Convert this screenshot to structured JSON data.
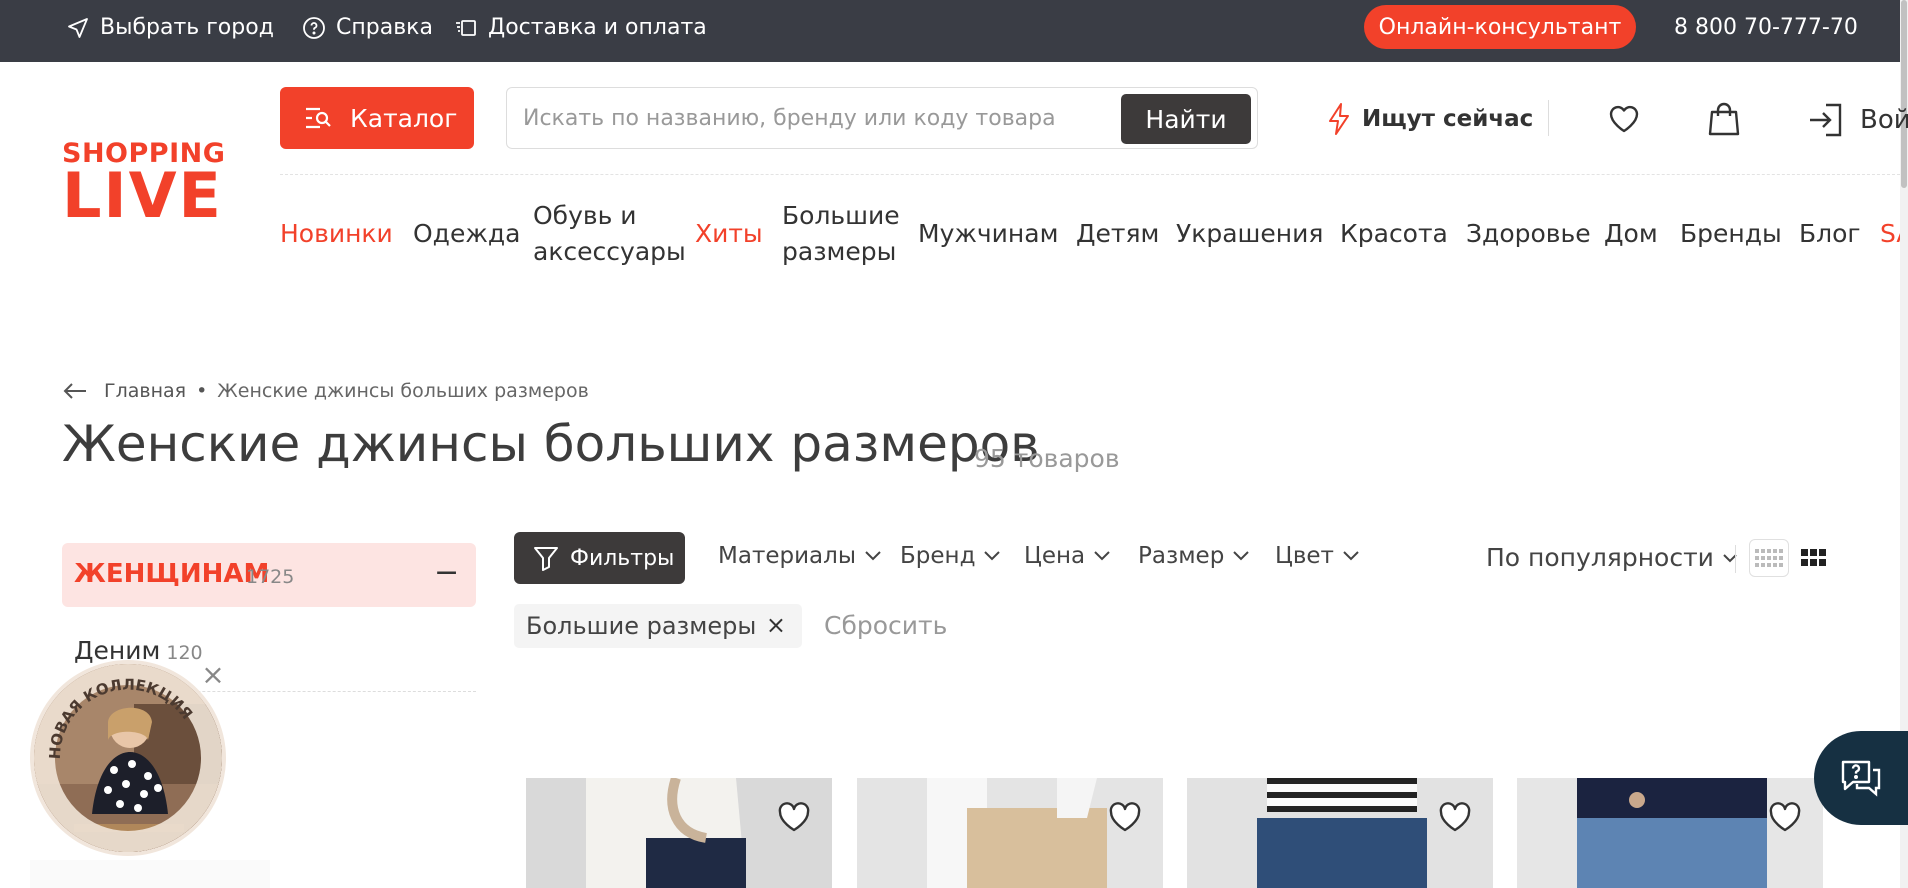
{
  "topbar": {
    "city": "Выбрать город",
    "help": "Справка",
    "delivery": "Доставка и оплата",
    "consultant": "Онлайн-консультант",
    "phone": "8 800 70-777-70"
  },
  "logo": {
    "line1": "SHOPPING",
    "line2": "LIVE"
  },
  "header": {
    "catalog": "Каталог",
    "search_placeholder": "Искать по названию, бренду или коду товара",
    "search_button": "Найти",
    "trending": "Ищут сейчас",
    "login": "Войти"
  },
  "nav": [
    {
      "label": "Новинки"
    },
    {
      "label": "Одежда"
    },
    {
      "label": "Обувь и аксессуары"
    },
    {
      "label": "Хиты"
    },
    {
      "label": "Большие размеры"
    },
    {
      "label": "Мужчинам"
    },
    {
      "label": "Детям"
    },
    {
      "label": "Украшения"
    },
    {
      "label": "Красота"
    },
    {
      "label": "Здоровье"
    },
    {
      "label": "Дом"
    },
    {
      "label": "Бренды"
    },
    {
      "label": "Блог"
    },
    {
      "label": "SALE"
    }
  ],
  "breadcrumb": {
    "home": "Главная",
    "separator": "•",
    "current": "Женские джинсы больших размеров"
  },
  "page": {
    "title": "Женские джинсы больших размеров",
    "count": "95 товаров"
  },
  "sidebar": {
    "category": {
      "label": "ЖЕНЩИНАМ",
      "count": "1725",
      "toggle": "−"
    },
    "items": [
      {
        "label": "Деним",
        "count": "120"
      }
    ]
  },
  "promo": {
    "text": "НОВАЯ КОЛЛЕКЦИЯ"
  },
  "filters": {
    "button": "Фильтры",
    "dropdowns": [
      "Материалы",
      "Бренд",
      "Цена",
      "Размер",
      "Цвет"
    ],
    "sort": "По популярности",
    "active_chip": "Большие размеры",
    "chip_remove": "×",
    "reset": "Сбросить"
  },
  "colors": {
    "accent": "#f2412a",
    "topbar": "#3a3d45",
    "dark_button": "#3d3a3a",
    "chat": "#163042"
  },
  "icons": [
    "location-arrow-icon",
    "help-circle-icon",
    "delivery-icon",
    "catalog-search-icon",
    "lightning-icon",
    "heart-icon",
    "bag-icon",
    "login-icon",
    "back-arrow-icon",
    "filter-funnel-icon",
    "chevron-down-icon",
    "grid-small-icon",
    "grid-large-icon",
    "close-icon",
    "chat-help-icon"
  ]
}
